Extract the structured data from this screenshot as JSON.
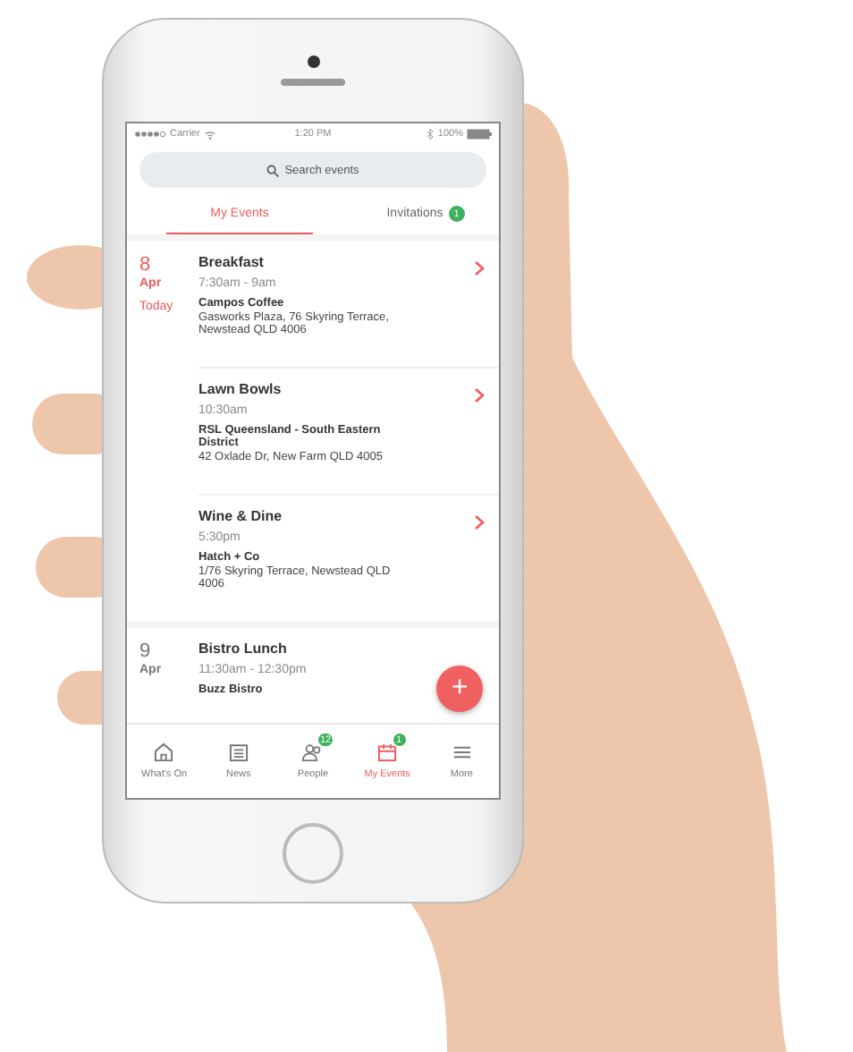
{
  "status_bar": {
    "carrier": "Carrier",
    "time": "1:20 PM",
    "battery": "100%"
  },
  "search": {
    "placeholder": "Search events"
  },
  "tabs": [
    {
      "label": "My Events",
      "selected": true
    },
    {
      "label": "Invitations",
      "selected": false,
      "badge": "1"
    }
  ],
  "date_groups": [
    {
      "day": "8",
      "month": "Apr",
      "today": "Today",
      "events": [
        {
          "title": "Breakfast",
          "time": "7:30am - 9am",
          "venue": "Campos Coffee",
          "address": "Gasworks Plaza, 76 Skyring Terrace, Newstead QLD 4006",
          "chevron": true
        },
        {
          "title": "Lawn Bowls",
          "time": "10:30am",
          "venue": "RSL Queensland - South Eastern District",
          "address": "42 Oxlade Dr, New Farm QLD 4005",
          "chevron": true
        },
        {
          "title": "Wine & Dine",
          "time": "5:30pm",
          "venue": "Hatch + Co",
          "address": "1/76 Skyring Terrace, Newstead QLD 4006",
          "chevron": true
        }
      ]
    },
    {
      "day": "9",
      "month": "Apr",
      "events": [
        {
          "title": "Bistro Lunch",
          "time": "11:30am - 12:30pm",
          "venue": "Buzz Bistro",
          "chevron": false
        }
      ]
    }
  ],
  "fab": {
    "label": "+"
  },
  "bottom_nav": [
    {
      "kind": "home",
      "label": "What's On",
      "selected": false
    },
    {
      "kind": "news",
      "label": "News",
      "selected": false
    },
    {
      "kind": "people",
      "label": "People",
      "selected": false,
      "badge": "12"
    },
    {
      "kind": "calendar",
      "label": "My Events",
      "selected": true,
      "badge": "1"
    },
    {
      "kind": "menu",
      "label": "More",
      "selected": false
    }
  ]
}
